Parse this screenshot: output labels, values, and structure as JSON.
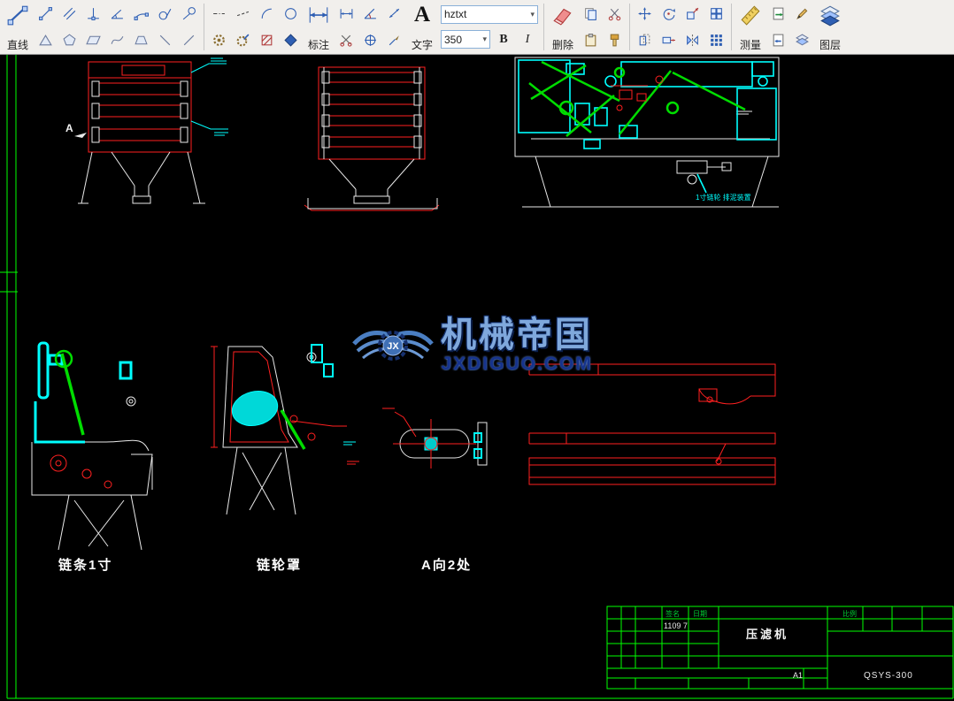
{
  "toolbar": {
    "panels": {
      "line": {
        "label": "直线"
      },
      "dimension": {
        "label": "标注"
      },
      "text": {
        "label": "文字",
        "big_icon_letter": "A"
      },
      "erase": {
        "label": "删除"
      },
      "measure": {
        "label": "测量"
      },
      "layer": {
        "label": "图层"
      }
    },
    "font_combo": {
      "value": "hztxt"
    },
    "size_combo": {
      "value": "350"
    },
    "bold_label": "B",
    "italic_label": "I",
    "icon_groups": [
      {
        "rows": [
          [
            "line-2pt",
            "parallel-line",
            "perp-line",
            "angle-line",
            "arc-3pt",
            "tangent-circle",
            "tangent-line"
          ],
          [
            "triangle",
            "pentagon",
            "parallelogram",
            "spline",
            "trapezoid",
            "backslash-line",
            "slash-line"
          ]
        ]
      },
      {
        "rows": [
          [
            "dashdot-line",
            "dash-line",
            "arc",
            "circle"
          ],
          [
            "gear",
            "gear-edit",
            "hatch",
            "block"
          ]
        ]
      },
      {
        "rows": [
          [
            "linear-dim",
            "angle-dim",
            "aligned-dim"
          ],
          [
            "dim-edit",
            "datum",
            "leader"
          ]
        ]
      },
      {
        "rows": [
          [
            "copy",
            "cut"
          ],
          [
            "paste",
            "format-brush"
          ]
        ]
      },
      {
        "rows": [
          [
            "move",
            "rotate",
            "scale",
            "array"
          ],
          [
            "offset",
            "stretch",
            "mirror",
            "grid-array"
          ]
        ]
      },
      {
        "rows": [
          [
            "export-sheet"
          ],
          [
            "import-sheet"
          ]
        ]
      },
      {
        "rows": [
          [
            "pencil"
          ],
          [
            "layers-small"
          ]
        ]
      }
    ]
  },
  "canvas": {
    "view_marker": "A",
    "detail_labels": [
      {
        "text": "链条1寸"
      },
      {
        "text": "链轮罩"
      },
      {
        "text": "A向2处"
      }
    ],
    "annotation": "1寸链轮 排泥装置",
    "watermark": {
      "brand": "机械帝国",
      "site": "JXDIGUO.COM",
      "emblem_text": "JX"
    },
    "title_block": {
      "sign_label": "签名",
      "date_label": "日期",
      "date_value": "1109 7",
      "product_name": "压滤机",
      "scale_label": "比例",
      "sheet_size": "A1",
      "drawing_no": "QSYS-300"
    },
    "colors": {
      "entity_red": "#ff2020",
      "entity_cyan": "#00ffff",
      "entity_green": "#00dd00",
      "entity_white": "#e8e8e8",
      "sheet_green": "#00ff00",
      "watermark_blue": "#4a7ec2"
    }
  }
}
